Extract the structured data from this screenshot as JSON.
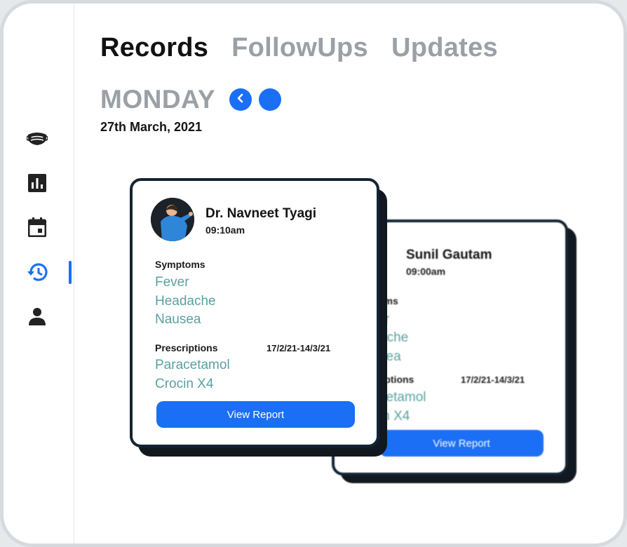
{
  "tabs": [
    {
      "label": "Records",
      "active": true
    },
    {
      "label": "FollowUps",
      "active": false
    },
    {
      "label": "Updates",
      "active": false
    }
  ],
  "day": "MONDAY",
  "date": "27th March, 2021",
  "sidebar": {
    "items": [
      {
        "icon": "mask-icon"
      },
      {
        "icon": "chart-icon"
      },
      {
        "icon": "calendar-icon"
      },
      {
        "icon": "history-icon",
        "active": true
      },
      {
        "icon": "person-icon"
      }
    ]
  },
  "front_card": {
    "doctor": "Dr. Navneet Tyagi",
    "time": "09:10am",
    "symptoms_label": "Symptoms",
    "symptoms": [
      "Fever",
      "Headache",
      "Nausea"
    ],
    "prescriptions_label": "Prescriptions",
    "date_range": "17/2/21-14/3/21",
    "prescriptions": [
      "Paracetamol",
      "Crocin X4"
    ],
    "button": "View Report"
  },
  "back_card": {
    "doctor": "Sunil Gautam",
    "time": "09:00am",
    "symptoms_label": "oms",
    "symptoms": [
      "r",
      "ache",
      "sea"
    ],
    "prescriptions_label": "riptions",
    "date_range": "17/2/21-14/3/21",
    "prescriptions": [
      "cetamol",
      "in X4"
    ],
    "button": "View Report"
  },
  "colors": {
    "accent": "#1a6ff5",
    "teal": "#5aa0a0",
    "card_border": "#132433"
  }
}
